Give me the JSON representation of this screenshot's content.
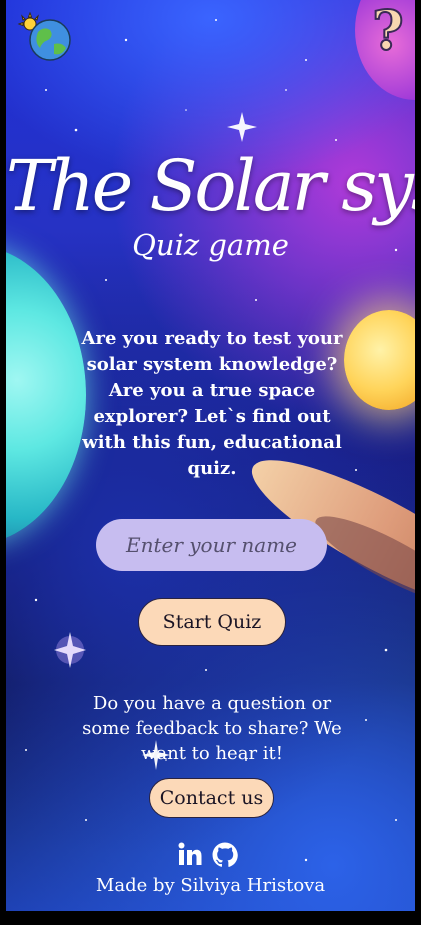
{
  "header": {
    "logo_icon": "earth-with-sun-icon",
    "help_icon": "question-mark-icon",
    "help_label": "?"
  },
  "hero": {
    "title": "The Solar system",
    "subtitle": "Quiz game",
    "intro": "Are you ready to test your solar system knowledge? Are you a true space explorer? Let`s find out with this fun, educational quiz."
  },
  "form": {
    "name_placeholder": "Enter your name",
    "start_label": "Start Quiz"
  },
  "contact": {
    "prompt": "Do you have a question or some feedback to share? We want to hear it!",
    "button_label": "Contact us"
  },
  "social": {
    "linkedin_icon": "linkedin-icon",
    "github_icon": "github-icon"
  },
  "footer": {
    "credit": "Made by Silviya Hristova"
  },
  "colors": {
    "input_bg": "#c7bdf0",
    "button_bg": "#fcd9b8",
    "text": "#ffffff"
  }
}
